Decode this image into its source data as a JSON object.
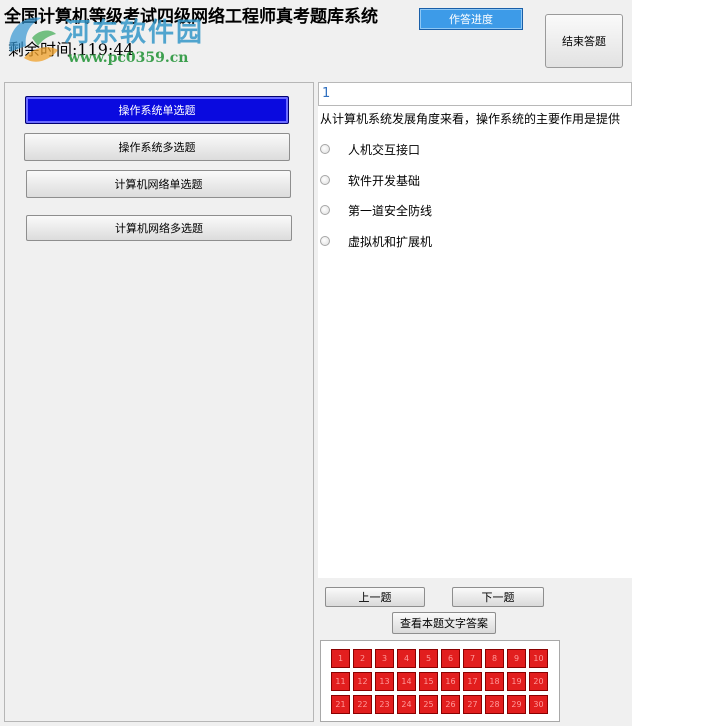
{
  "window": {
    "title": "全国计算机等级考试四级网络工程师真考题库系统",
    "timer_text": "剩余时间:119:44"
  },
  "watermark": {
    "site_name": "河东软件园",
    "url": "www.pc0359.cn"
  },
  "toolbar": {
    "progress_label": "作答进度",
    "finish_label": "结束答题"
  },
  "categories": [
    {
      "label": "操作系统单选题",
      "active": true
    },
    {
      "label": "操作系统多选题",
      "active": false
    },
    {
      "label": "计算机网络单选题",
      "active": false
    },
    {
      "label": "计算机网络多选题",
      "active": false
    }
  ],
  "question": {
    "number": "1",
    "text": "从计算机系统发展角度来看，操作系统的主要作用是提供",
    "options": [
      "人机交互接口",
      "软件开发基础",
      "第一道安全防线",
      "虚拟机和扩展机"
    ]
  },
  "navigation": {
    "prev_label": "上一题",
    "next_label": "下一题",
    "answer_label": "查看本题文字答案"
  },
  "question_grid": {
    "cells": [
      "1",
      "2",
      "3",
      "4",
      "5",
      "6",
      "7",
      "8",
      "9",
      "10",
      "11",
      "12",
      "13",
      "14",
      "15",
      "16",
      "17",
      "18",
      "19",
      "20",
      "21",
      "22",
      "23",
      "24",
      "25",
      "26",
      "27",
      "28",
      "29",
      "30"
    ],
    "cell_color": "#e21e1e"
  },
  "colors": {
    "active_category": "#0a0adf",
    "progress_button": "#3d9be8",
    "question_number": "#3070c0"
  }
}
